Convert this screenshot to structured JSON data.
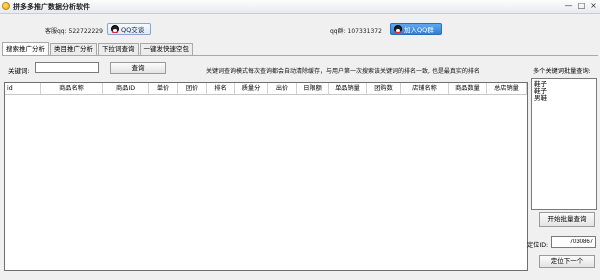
{
  "window": {
    "title": "拼多多推广数据分析软件",
    "controls": {
      "minimize": "—",
      "maximize": "□",
      "close": "×"
    }
  },
  "header": {
    "support_label": "客服qq: 522722229",
    "qq_contact_button": "QQ交谈",
    "group_label": "qq群: 107331372",
    "join_group_button": "加入QQ群"
  },
  "tabs": [
    {
      "label": "搜索推广分析",
      "active": true
    },
    {
      "label": "类目推广分析",
      "active": false
    },
    {
      "label": "下拉词查询",
      "active": false
    },
    {
      "label": "一键发快速空包",
      "active": false
    }
  ],
  "search": {
    "keyword_label": "关键词:",
    "keyword_value": "",
    "query_button": "查询",
    "hint": "关键词查询模式每次查询都会自动清除缓存，与用户第一次搜索该关键词的排名一致, 也是最真实的排名"
  },
  "table": {
    "columns": [
      "id",
      "商品名称",
      "商品ID",
      "单价",
      "团价",
      "排名",
      "质量分",
      "出价",
      "日限额",
      "单品销量",
      "团购数",
      "店铺名称",
      "商品数量",
      "总店销量"
    ],
    "rows": []
  },
  "batch": {
    "label": "多个关键词批量查询:",
    "textarea_value": "鞋子\n鞋子\n男鞋",
    "start_button": "开始批量查询"
  },
  "locate": {
    "label": "定位ID:",
    "value": "7030867",
    "next_button": "定位下一个"
  }
}
